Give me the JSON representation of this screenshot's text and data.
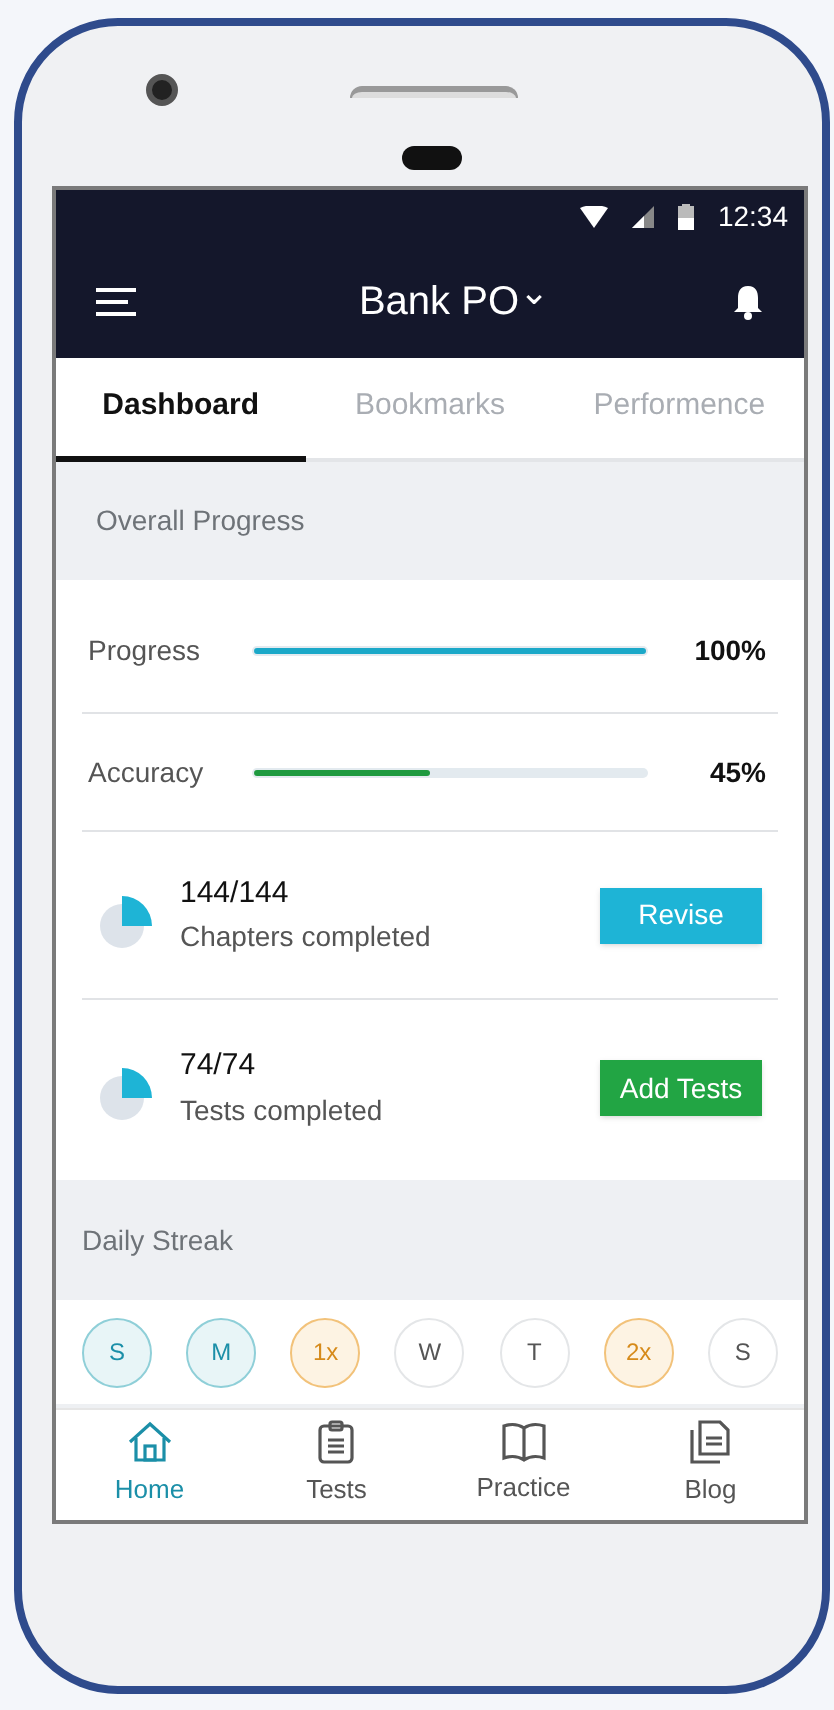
{
  "status_bar": {
    "time": "12:34"
  },
  "app_bar": {
    "title": "Bank PO",
    "dropdown": "⌄"
  },
  "tabs": [
    {
      "label": "Dashboard",
      "selected": true
    },
    {
      "label": "Bookmarks",
      "selected": false
    },
    {
      "label": "Performence",
      "selected": false
    }
  ],
  "overall_progress": {
    "heading": "Overall Progress",
    "meters": [
      {
        "label": "Progress",
        "level": 1.0,
        "color": "#1ba8c8",
        "reading": "100%"
      },
      {
        "label": "Accuracy",
        "level": 0.45,
        "color": "#1f9a3f",
        "reading": "45%"
      }
    ],
    "stats": [
      {
        "count": "144/144",
        "label": "Chapters completed",
        "button": "Revise",
        "color": "#1eb4d6"
      },
      {
        "count": "74/74",
        "label": "Tests completed",
        "button": "Add Tests",
        "color": "#22a544"
      }
    ]
  },
  "daily_streak": {
    "heading": "Daily Streak",
    "days": [
      {
        "kind": "day",
        "label": "S",
        "completed": true
      },
      {
        "kind": "day",
        "label": "M",
        "completed": true
      },
      {
        "kind": "multiplier",
        "label": "1x"
      },
      {
        "kind": "day",
        "label": "W",
        "completed": false
      },
      {
        "kind": "day",
        "label": "T",
        "completed": false
      },
      {
        "kind": "multiplier",
        "label": "2x"
      },
      {
        "kind": "day",
        "label": "S",
        "completed": false
      }
    ]
  },
  "bottom_nav": [
    {
      "label": "Home",
      "selected": true
    },
    {
      "label": "Tests",
      "selected": false
    },
    {
      "label": "Practice",
      "selected": false
    },
    {
      "label": "Blog",
      "selected": false
    }
  ]
}
